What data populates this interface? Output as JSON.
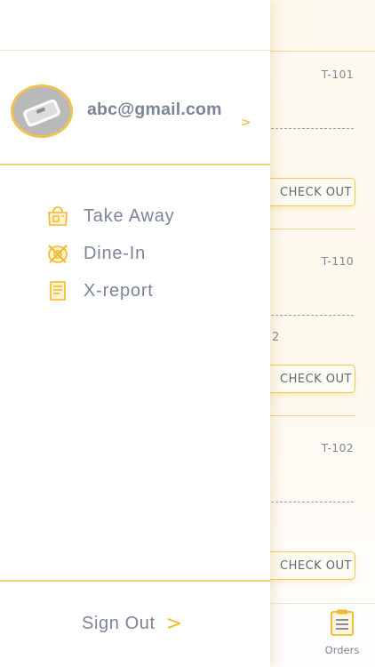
{
  "background": {
    "orders": [
      {
        "table": "T-101",
        "qty": "",
        "checkout_label": "CHECK OUT"
      },
      {
        "table": "T-110",
        "qty": "2",
        "checkout_label": "CHECK OUT"
      },
      {
        "table": "T-102",
        "qty": "",
        "checkout_label": "CHECK OUT"
      }
    ],
    "tabbar": {
      "orders_label": "Orders",
      "orders_icon": "clipboard-list-icon"
    }
  },
  "drawer": {
    "user": {
      "email": "abc@gmail.com",
      "chevron": ">",
      "avatar_icon": "scale-avatar-icon"
    },
    "menu": [
      {
        "label": "Take Away",
        "icon": "takeaway-bag-icon"
      },
      {
        "label": "Dine-In",
        "icon": "dine-in-plate-icon"
      },
      {
        "label": "X-report",
        "icon": "report-document-icon"
      }
    ],
    "signout": {
      "label": "Sign Out",
      "chevron": ">"
    }
  },
  "colors": {
    "accent": "#f3b829",
    "divider": "#f4cf7b",
    "text": "#7b8597",
    "avatar_bg": "#b9b9b9"
  }
}
